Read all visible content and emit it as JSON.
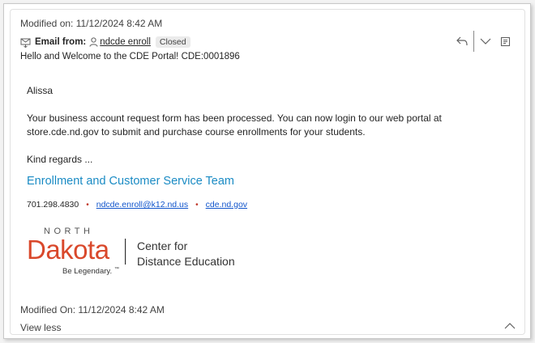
{
  "header": {
    "modified_top": "Modified on: 11/12/2024 8:42 AM",
    "from_label": "Email from:",
    "sender": "ndcde enroll",
    "status_badge": "Closed",
    "subject": "Hello and Welcome to the CDE Portal! CDE:0001896"
  },
  "actions": {
    "reply_icon": "reply-icon",
    "chevron_icon": "chevron-down-icon",
    "open_icon": "open-in-new-icon"
  },
  "email_body": {
    "greeting": "Alissa",
    "paragraph": "Your business account request form has been processed.  You can now login to our web portal at store.cde.nd.gov to submit and purchase course enrollments for your students.",
    "signoff": "Kind regards ...",
    "team": "Enrollment and Customer Service Team",
    "phone": "701.298.4830",
    "email": "ndcde.enroll@k12.nd.us",
    "website": "cde.nd.gov"
  },
  "logo": {
    "north": "NORTH",
    "dakota": "Dakota",
    "tagline": "Be Legendary.",
    "tm": "™",
    "center_line1": "Center for",
    "center_line2": "Distance Education",
    "brand_color": "#d9482b"
  },
  "footer": {
    "modified_bottom": "Modified On: 11/12/2024 8:42 AM",
    "view_less": "View less"
  }
}
